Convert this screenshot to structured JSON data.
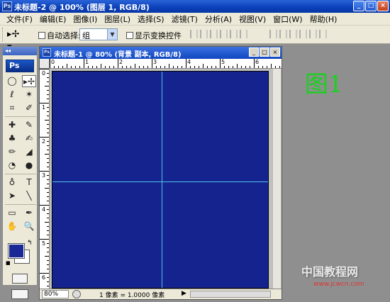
{
  "window": {
    "app_icon": "Ps",
    "title": "未标题-2 @ 100% (图层 1, RGB/8)",
    "minimize": "_",
    "maximize": "□",
    "close": "×"
  },
  "menu": [
    "文件(F)",
    "编辑(E)",
    "图像(I)",
    "图层(L)",
    "选择(S)",
    "滤镜(T)",
    "分析(A)",
    "视图(V)",
    "窗口(W)",
    "帮助(H)"
  ],
  "options": {
    "tool_icon": "▸✢ ▾",
    "auto_select_label": "自动选择:",
    "auto_select_value": "组",
    "show_transform_label": "显示变换控件"
  },
  "toolbox": {
    "collapse": "◂◂",
    "logo": "Ps",
    "tools": [
      "◯",
      "▸✢",
      "ℓ",
      "✶",
      "⌗",
      "✐",
      "✚",
      "✎",
      "♣",
      "✍",
      "✏",
      "◢",
      "◔",
      "●",
      "♁",
      "T",
      "➤",
      "╲",
      "▭",
      "✒",
      "✋",
      "🔍"
    ]
  },
  "document": {
    "icon": "Ps",
    "title": "未标题-1 @ 80% (背景 副本, RGB/8)",
    "minimize": "_",
    "maximize": "□",
    "close": "×",
    "ruler_h": [
      "0",
      "1",
      "2",
      "3",
      "4",
      "5",
      "6"
    ],
    "ruler_v": [
      "0",
      "1",
      "2",
      "3",
      "4",
      "5",
      "6"
    ],
    "zoom": "80%",
    "status_info": "1 像素 = 1.0000 像素",
    "status_arrow": "▶"
  },
  "colors": {
    "canvas": "#15238f",
    "guide": "#4fc1e6",
    "foreground": "#1a2896",
    "background": "#ffffff",
    "label": "#19d21e"
  },
  "figure_label": "图1",
  "watermark": "中国教程网",
  "watermark_url": "www.jcwcn.com"
}
